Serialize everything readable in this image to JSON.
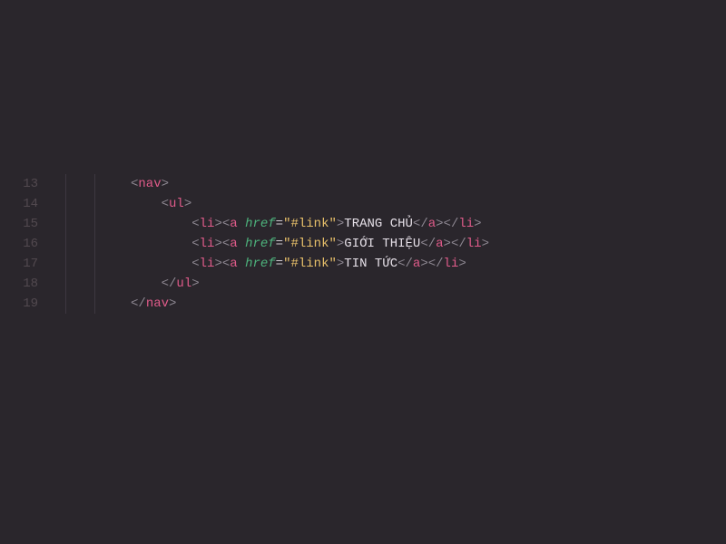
{
  "lineNumbers": [
    "13",
    "14",
    "15",
    "16",
    "17",
    "18",
    "19"
  ],
  "tags": {
    "nav": "nav",
    "ul": "ul",
    "li": "li",
    "a": "a"
  },
  "attr": {
    "href": "href",
    "eq": "=",
    "val": "\"#link\""
  },
  "brackets": {
    "open": "<",
    "openClose": "</",
    "close": ">"
  },
  "content": {
    "item1": "TRANG CHỦ",
    "item2": "GIỚI THIỆU",
    "item3": "TIN TỨC"
  }
}
